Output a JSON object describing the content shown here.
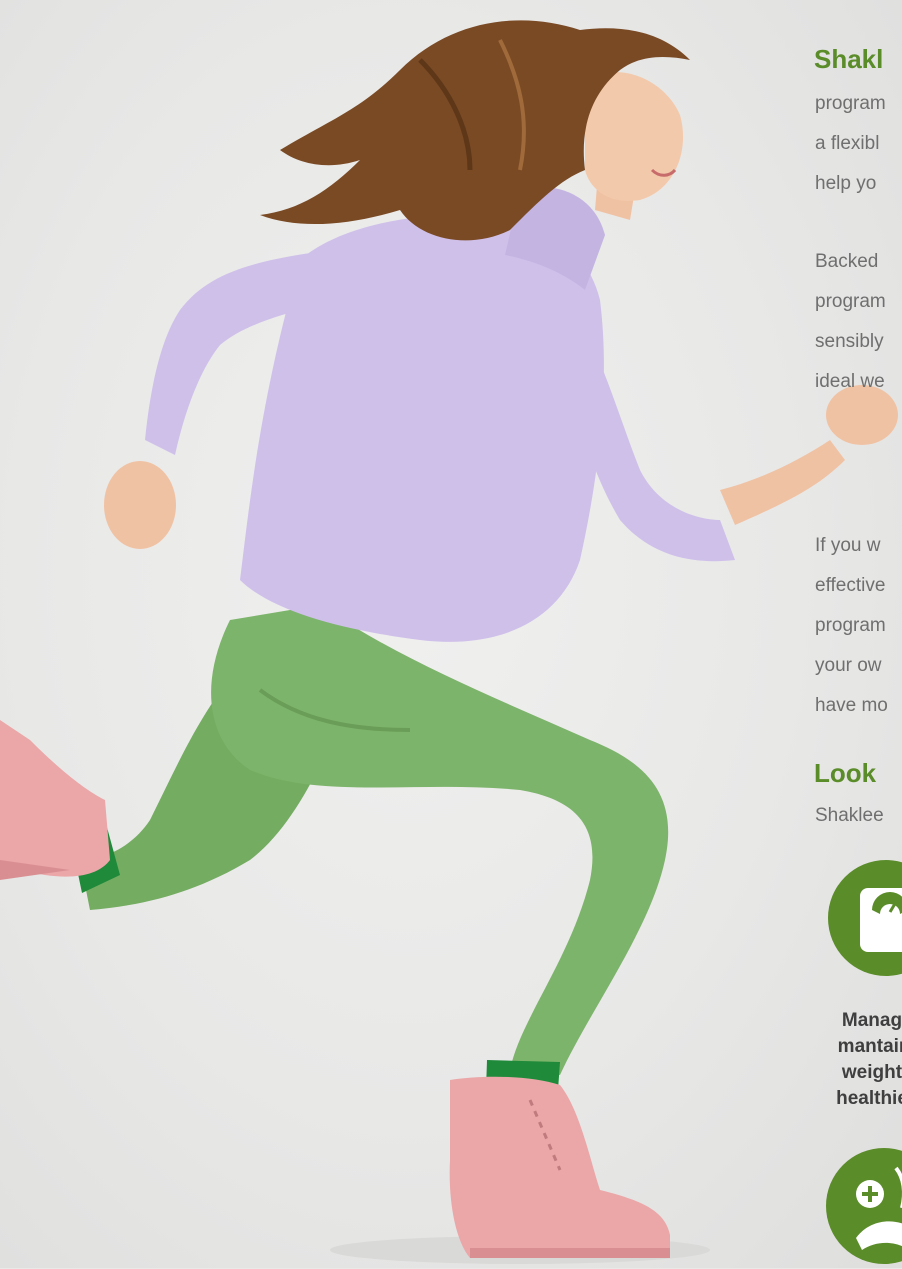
{
  "section_title": "Shakl",
  "paragraph_1": [
    "program",
    "a flexibl",
    "help yo"
  ],
  "paragraph_2": [
    "Backed",
    "program",
    "sensibly",
    "ideal we"
  ],
  "paragraph_3": [
    "If you w",
    "effective",
    "program",
    "your ow",
    "have mo"
  ],
  "look_heading": "Look",
  "look_subtitle": "Shaklee",
  "feature_1": [
    "Manag",
    "mantair",
    "weight",
    "healthie"
  ],
  "colors": {
    "accent_green": "#5b8c2a",
    "sweater": "#cfc0ea",
    "pants": "#7db46b",
    "boots": "#eba6a8",
    "hair": "#7a4a25",
    "socks": "#1f8a3a"
  },
  "icons": [
    "scale-icon",
    "health-meal-icon"
  ]
}
